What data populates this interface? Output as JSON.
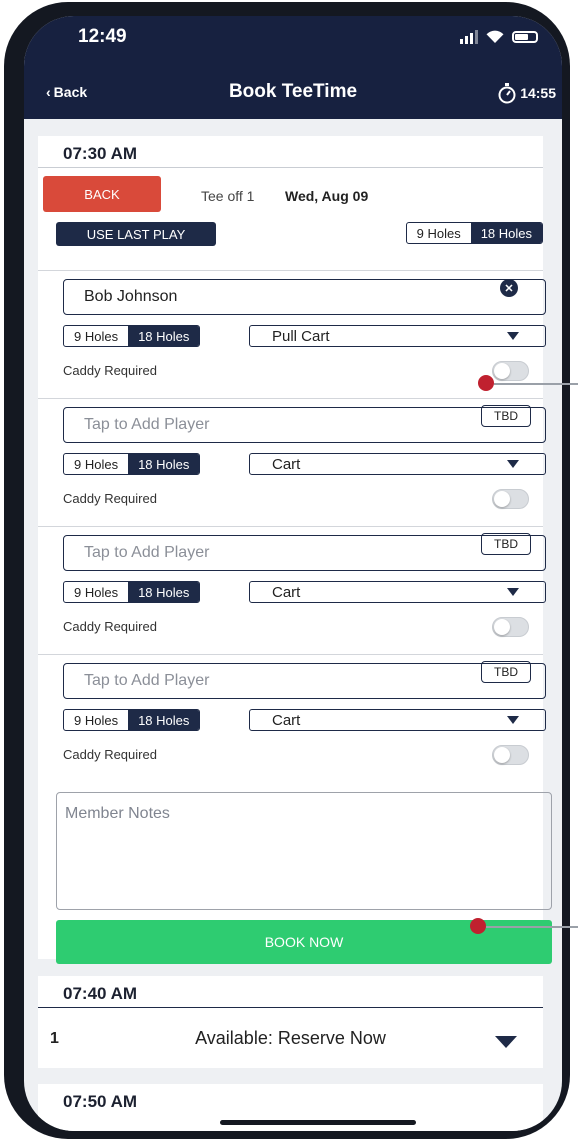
{
  "status_bar": {
    "time": "12:49"
  },
  "nav": {
    "back_label": "Back",
    "title": "Book TeeTime",
    "timer": "14:55"
  },
  "booking": {
    "time": "07:30 AM",
    "back_button": "BACK",
    "tee_off": "Tee off 1",
    "date": "Wed, Aug 09",
    "use_last_play": "USE LAST PLAY",
    "holes_options": [
      "9 Holes",
      "18 Holes"
    ],
    "selected_holes": "18 Holes",
    "players": [
      {
        "name": "Bob Johnson",
        "placeholder": "",
        "holes_9": "9 Holes",
        "holes_18": "18 Holes",
        "cart": "Pull Cart",
        "caddy_label": "Caddy Required",
        "caddy_required": false
      },
      {
        "name": "",
        "placeholder": "Tap to Add Player",
        "tbd": "TBD",
        "holes_9": "9 Holes",
        "holes_18": "18 Holes",
        "cart": "Cart",
        "caddy_label": "Caddy Required",
        "caddy_required": false
      },
      {
        "name": "",
        "placeholder": "Tap to Add Player",
        "tbd": "TBD",
        "holes_9": "9 Holes",
        "holes_18": "18 Holes",
        "cart": "Cart",
        "caddy_label": "Caddy Required",
        "caddy_required": false
      },
      {
        "name": "",
        "placeholder": "Tap to Add Player",
        "tbd": "TBD",
        "holes_9": "9 Holes",
        "holes_18": "18 Holes",
        "cart": "Cart",
        "caddy_label": "Caddy Required",
        "caddy_required": false
      }
    ],
    "notes_placeholder": "Member Notes",
    "book_now": "BOOK NOW"
  },
  "next_slot": {
    "time": "07:40 AM",
    "number": "1",
    "status": "Available: Reserve Now"
  },
  "third_slot": {
    "time": "07:50 AM"
  },
  "colors": {
    "navy": "#1e2a47",
    "header": "#172140",
    "back_red": "#d94a3a",
    "book_green": "#2ecc71",
    "marker_red": "#c0212f"
  }
}
